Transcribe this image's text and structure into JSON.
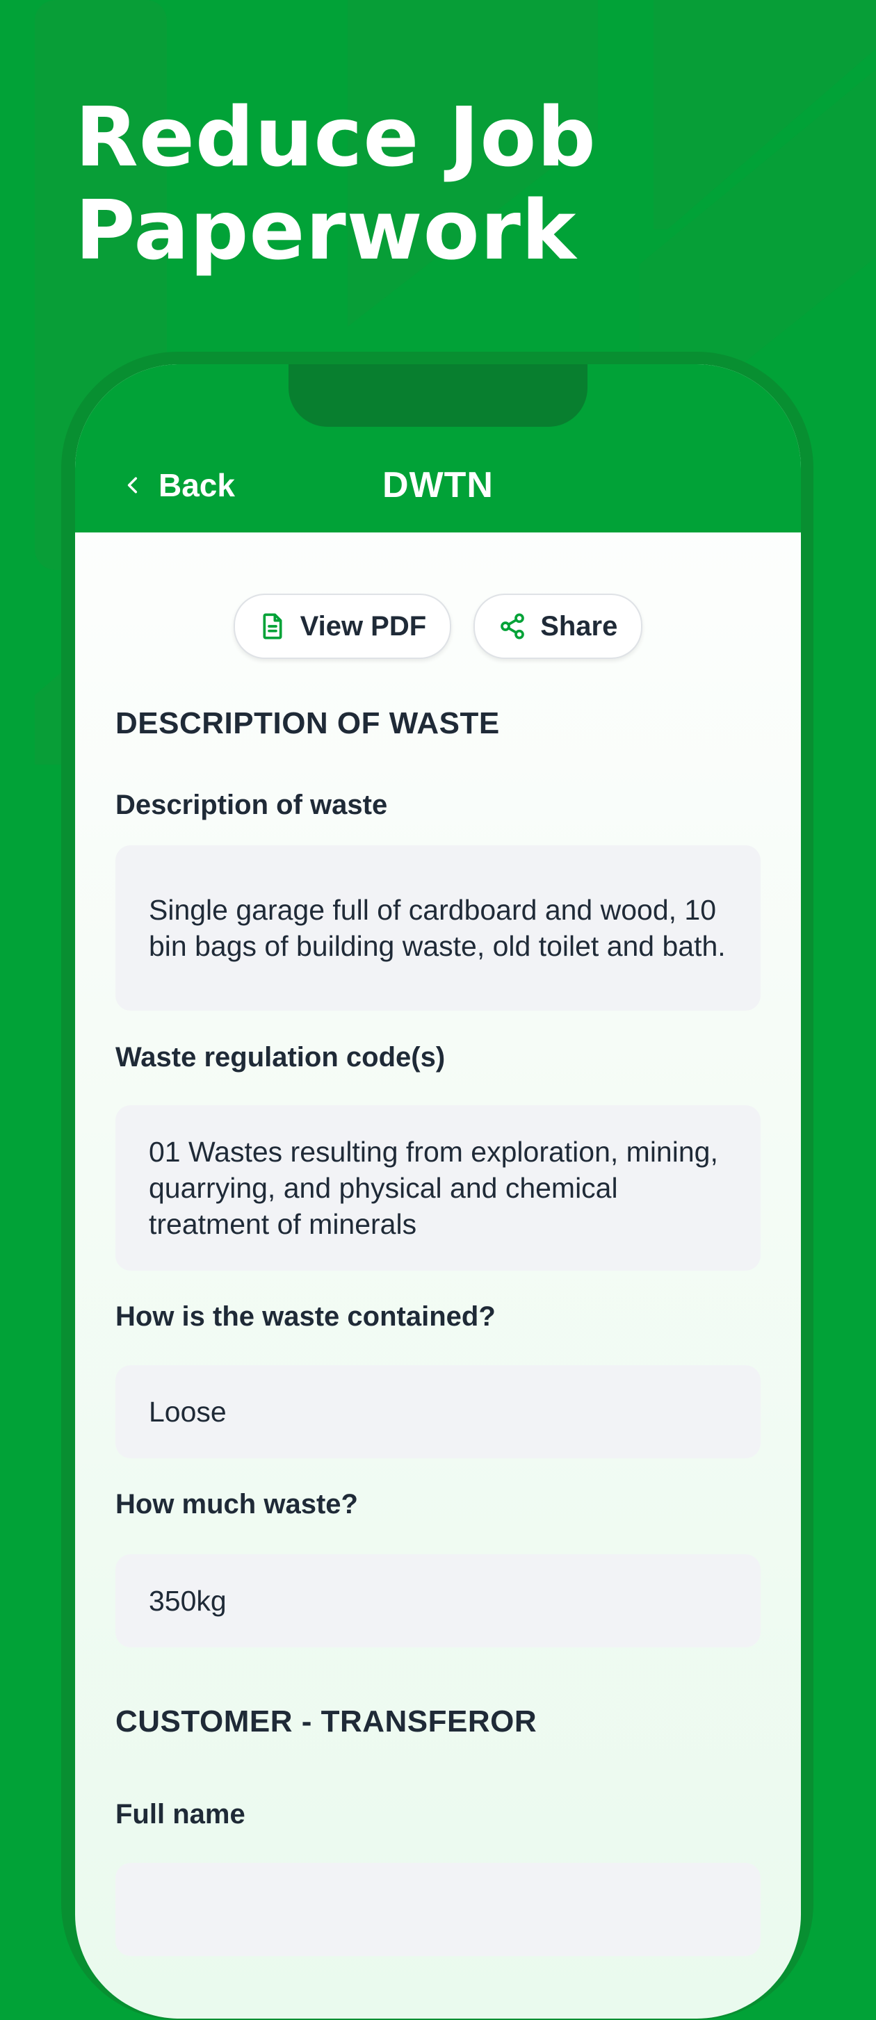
{
  "headline": {
    "line1": "Reduce Job",
    "line2": "Paperwork"
  },
  "nav": {
    "back_label": "Back",
    "title": "DWTN"
  },
  "actions": {
    "view_pdf": "View PDF",
    "share": "Share"
  },
  "sections": {
    "waste": {
      "title": "DESCRIPTION OF WASTE",
      "fields": [
        {
          "label": "Description of waste",
          "value": "Single garage full of cardboard and wood, 10 bin bags of building waste, old toilet and bath."
        },
        {
          "label": "Waste regulation code(s)",
          "value": "01 Wastes resulting from exploration, mining, quarrying, and physical and chemical treatment of minerals"
        },
        {
          "label": "How is the waste contained?",
          "value": "Loose"
        },
        {
          "label": "How much waste?",
          "value": "350kg"
        }
      ]
    },
    "customer": {
      "title": "CUSTOMER - TRANSFEROR",
      "fields": [
        {
          "label": "Full name",
          "value": ""
        }
      ]
    }
  },
  "colors": {
    "brand_green": "#01a237",
    "frame_green": "#088f31",
    "notch_green": "#087f2f",
    "text_dark": "#1f2a37",
    "field_bg": "#f2f3f6"
  },
  "icons": {
    "back": "chevron-left-icon",
    "pdf": "document-icon",
    "share": "share-icon"
  }
}
